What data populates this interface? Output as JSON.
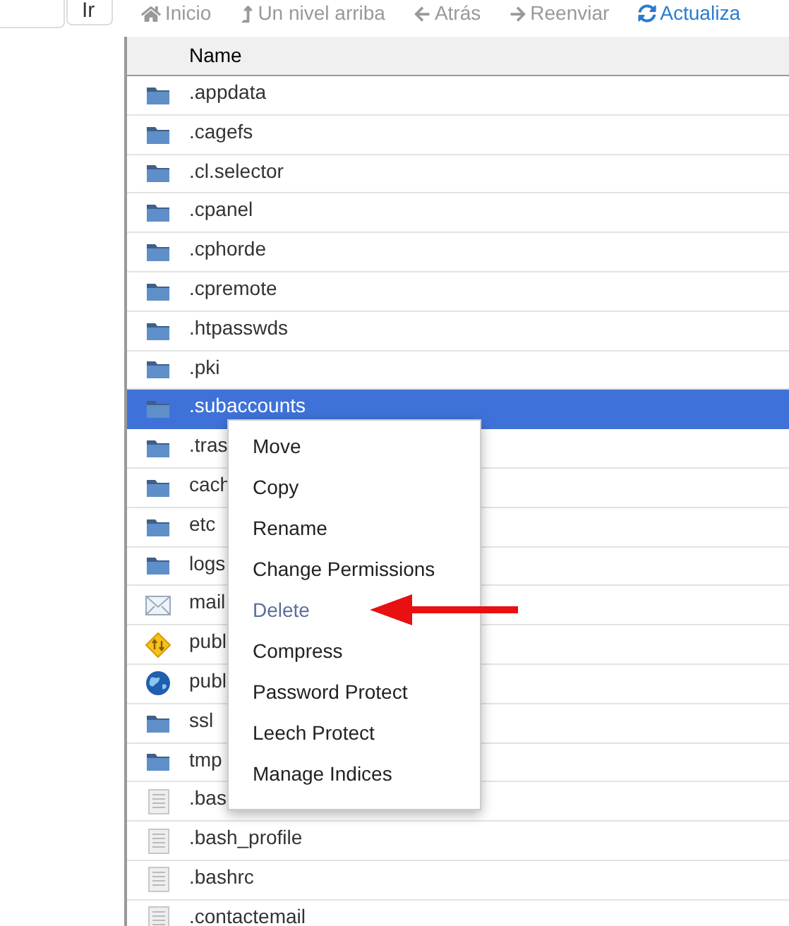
{
  "search": {
    "button": "Ir"
  },
  "toolbar": [
    {
      "kind": "home",
      "label": "Inicio"
    },
    {
      "kind": "up",
      "label": "Un nivel arriba"
    },
    {
      "kind": "back",
      "label": "Atrás"
    },
    {
      "kind": "forward",
      "label": "Reenviar"
    },
    {
      "kind": "reload",
      "label": "Actualiza"
    }
  ],
  "table": {
    "columns": [
      "Name"
    ],
    "rows": [
      {
        "kind": "folder",
        "name": ".appdata",
        "selected": false
      },
      {
        "kind": "folder",
        "name": ".cagefs",
        "selected": false
      },
      {
        "kind": "folder",
        "name": ".cl.selector",
        "selected": false
      },
      {
        "kind": "folder",
        "name": ".cpanel",
        "selected": false
      },
      {
        "kind": "folder",
        "name": ".cphorde",
        "selected": false
      },
      {
        "kind": "folder",
        "name": ".cpremote",
        "selected": false
      },
      {
        "kind": "folder",
        "name": ".htpasswds",
        "selected": false
      },
      {
        "kind": "folder",
        "name": ".pki",
        "selected": false
      },
      {
        "kind": "folder",
        "name": ".subaccounts",
        "selected": true
      },
      {
        "kind": "folder",
        "name": ".tras",
        "selected": false
      },
      {
        "kind": "folder",
        "name": "cach",
        "selected": false
      },
      {
        "kind": "folder",
        "name": "etc",
        "selected": false
      },
      {
        "kind": "folder",
        "name": "logs",
        "selected": false
      },
      {
        "kind": "mail",
        "name": "mail",
        "selected": false
      },
      {
        "kind": "ftp",
        "name": "publ",
        "selected": false
      },
      {
        "kind": "web",
        "name": "publ",
        "selected": false
      },
      {
        "kind": "folder",
        "name": "ssl",
        "selected": false
      },
      {
        "kind": "folder",
        "name": "tmp",
        "selected": false
      },
      {
        "kind": "file",
        "name": ".bas",
        "selected": false
      },
      {
        "kind": "file",
        "name": ".bash_profile",
        "selected": false
      },
      {
        "kind": "file",
        "name": ".bashrc",
        "selected": false
      },
      {
        "kind": "file",
        "name": ".contactemail",
        "selected": false
      }
    ]
  },
  "context_menu": [
    {
      "label": "Move",
      "highlighted": false
    },
    {
      "label": "Copy",
      "highlighted": false
    },
    {
      "label": "Rename",
      "highlighted": false
    },
    {
      "label": "Change Permissions",
      "highlighted": false
    },
    {
      "label": "Delete",
      "highlighted": true
    },
    {
      "label": "Compress",
      "highlighted": false
    },
    {
      "label": "Password Protect",
      "highlighted": false
    },
    {
      "label": "Leech Protect",
      "highlighted": false
    },
    {
      "label": "Manage Indices",
      "highlighted": false
    }
  ],
  "annotation": {
    "kind": "arrow"
  }
}
